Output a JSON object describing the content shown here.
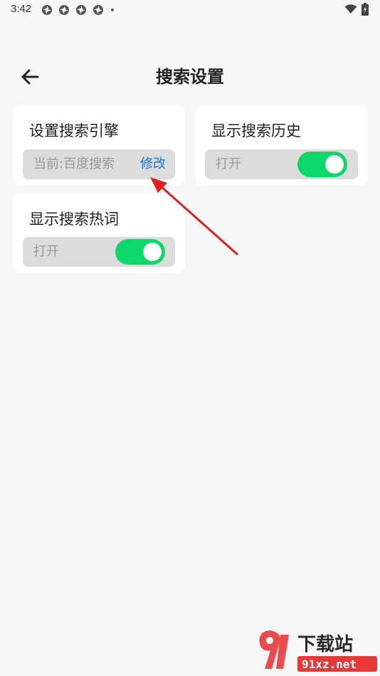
{
  "status_bar": {
    "time": "3:42",
    "notification_icons": [
      "notification-icon",
      "notification-icon",
      "notification-icon",
      "notification-icon"
    ],
    "wifi_icon": "wifi-icon",
    "battery_icon": "battery-icon"
  },
  "header": {
    "back_icon": "arrow-left-icon",
    "title": "搜索设置"
  },
  "cards": {
    "search_engine": {
      "title": "设置搜索引擎",
      "current": "当前:百度搜索",
      "edit_label": "修改"
    },
    "search_history": {
      "title": "显示搜索历史",
      "state_label": "打开",
      "enabled": true
    },
    "hot_words": {
      "title": "显示搜索热词",
      "state_label": "打开",
      "enabled": true
    }
  },
  "annotation": {
    "arrow_color": "#e02020"
  },
  "watermark": {
    "text": "下载站",
    "url": "91xz.net"
  },
  "colors": {
    "background": "#f7f7f7",
    "card": "#ffffff",
    "toggle_on": "#0dd66b",
    "link": "#1a73e8"
  }
}
